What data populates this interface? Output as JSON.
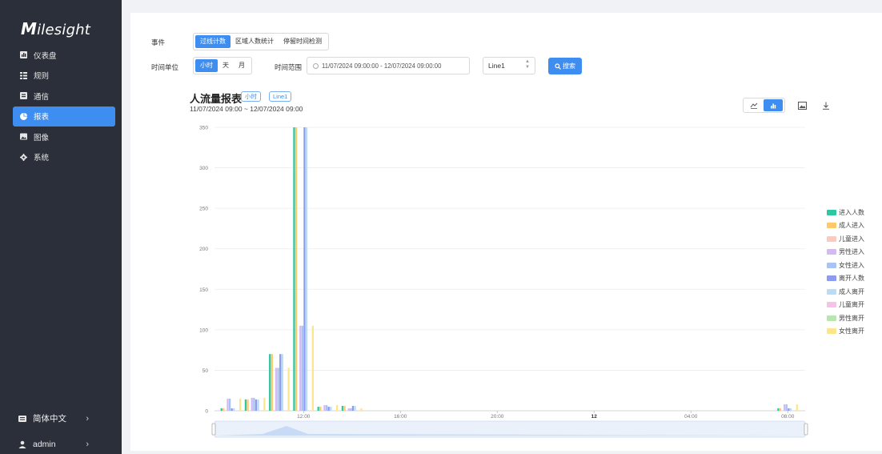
{
  "sidebar": {
    "logo": "Milesight",
    "items": [
      {
        "label": "仪表盘",
        "icon": "dashboard-icon",
        "active": false
      },
      {
        "label": "规则",
        "icon": "rules-icon",
        "active": false
      },
      {
        "label": "通信",
        "icon": "communication-icon",
        "active": false
      },
      {
        "label": "报表",
        "icon": "report-icon",
        "active": true
      },
      {
        "label": "图像",
        "icon": "image-icon",
        "active": false
      },
      {
        "label": "系统",
        "icon": "gear-icon",
        "active": false
      }
    ],
    "language": "简体中文",
    "user": "admin",
    "chevron": "›"
  },
  "filters": {
    "event_label": "事件",
    "events": [
      "过线计数",
      "区域人数统计",
      "停留时间检测"
    ],
    "unit_label": "时间单位",
    "units": [
      "小时",
      "天",
      "月"
    ],
    "range_label": "时间范围",
    "range_value": "11/07/2024 09:00:00  -  12/07/2024 09:00:00",
    "line_value": "Line1",
    "search_label": "搜索"
  },
  "chart_header": {
    "title": "人流量报表",
    "tags": [
      "小时",
      "Line1"
    ],
    "subtitle": "11/07/2024 09:00 ~ 12/07/2024 09:00"
  },
  "chart_data": {
    "type": "bar",
    "x_tick_labels": [
      "12:00",
      "16:00",
      "20:00",
      "12",
      "04:00",
      "08:00"
    ],
    "ylim": [
      0,
      350
    ],
    "y_ticks": [
      0,
      50,
      100,
      150,
      200,
      250,
      300,
      350
    ],
    "grid": true,
    "legend_position": "right",
    "groups": [
      {
        "hour": "09:00",
        "values": [
          3,
          3,
          0,
          15,
          15,
          3,
          3,
          0,
          0,
          15
        ]
      },
      {
        "hour": "10:00",
        "values": [
          14,
          14,
          0,
          16,
          16,
          14,
          14,
          0,
          0,
          16
        ]
      },
      {
        "hour": "11:00",
        "values": [
          70,
          70,
          0,
          53,
          53,
          70,
          70,
          0,
          0,
          53
        ]
      },
      {
        "hour": "12:00",
        "values": [
          350,
          350,
          0,
          105,
          105,
          350,
          350,
          0,
          0,
          105
        ]
      },
      {
        "hour": "13:00",
        "values": [
          5,
          5,
          0,
          7,
          7,
          5,
          5,
          0,
          0,
          7
        ]
      },
      {
        "hour": "14:00",
        "values": [
          6,
          6,
          0,
          3,
          3,
          6,
          6,
          0,
          0,
          3
        ]
      },
      {
        "hour": "08:00",
        "values": [
          3,
          3,
          0,
          8,
          8,
          3,
          3,
          0,
          0,
          8
        ]
      }
    ],
    "series": [
      {
        "name": "进入人数",
        "color": "#2ec7a3"
      },
      {
        "name": "成人进入",
        "color": "#ffc86b"
      },
      {
        "name": "儿童进入",
        "color": "#ffc9c0"
      },
      {
        "name": "男性进入",
        "color": "#d6b8f5"
      },
      {
        "name": "女性进入",
        "color": "#a9c3f5"
      },
      {
        "name": "离开人数",
        "color": "#8c9cf0"
      },
      {
        "name": "成人离开",
        "color": "#b9dcf7"
      },
      {
        "name": "儿童离开",
        "color": "#f6c2e6"
      },
      {
        "name": "男性离开",
        "color": "#b8e6b0"
      },
      {
        "name": "女性离开",
        "color": "#fde68a"
      }
    ],
    "brush_overview": true
  },
  "colors": {
    "accent": "#3d8ef0",
    "sidebar_bg": "#2b2f3a",
    "page_bg": "#f0f2f5"
  }
}
